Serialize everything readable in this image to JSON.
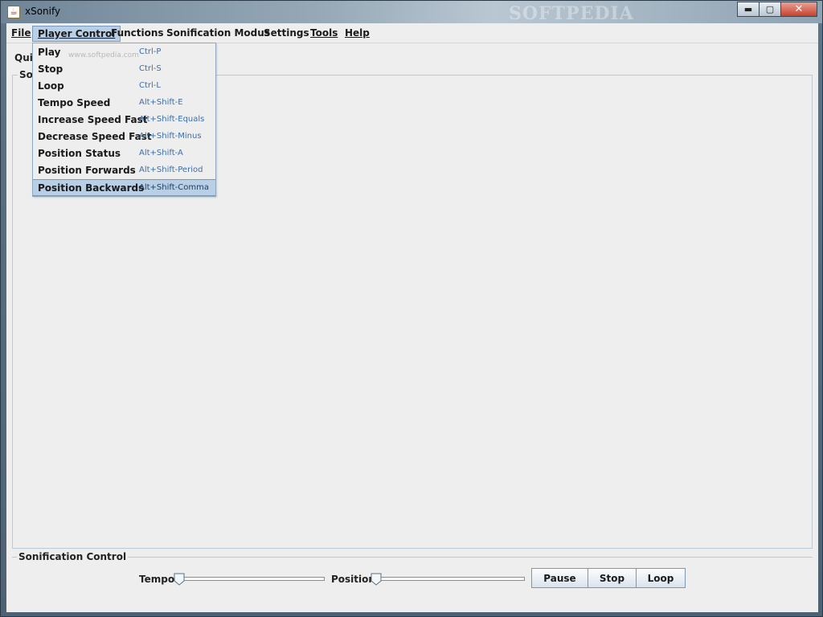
{
  "window": {
    "title": "xSonify",
    "app_icon": "java-cup-icon",
    "watermark": "SOFTPEDIA",
    "controls": {
      "minimize": "▬",
      "maximize": "▢",
      "close": "✕"
    }
  },
  "menubar": {
    "items": [
      {
        "label": "File"
      },
      {
        "label": "Player Control"
      },
      {
        "label": "Functions"
      },
      {
        "label": "Sonification Modus"
      },
      {
        "label": "Settings"
      },
      {
        "label": "Tools"
      },
      {
        "label": "Help"
      }
    ]
  },
  "dropdown": {
    "watermark": "www.softpedia.com",
    "items": [
      {
        "label": "Play",
        "accel": "Ctrl-P"
      },
      {
        "label": "Stop",
        "accel": "Ctrl-S"
      },
      {
        "label": "Loop",
        "accel": "Ctrl-L"
      },
      {
        "label": "Tempo Speed",
        "accel": "Alt+Shift-E"
      },
      {
        "label": "Increase Speed Fast",
        "accel": "Alt+Shift-Equals"
      },
      {
        "label": "Decrease Speed Fast",
        "accel": "Alt+Shift-Minus"
      },
      {
        "label": "Position Status",
        "accel": "Alt+Shift-A"
      },
      {
        "label": "Position Forwards",
        "accel": "Alt+Shift-Period"
      },
      {
        "label": "Position Backwards",
        "accel": "Alt+Shift-Comma"
      }
    ],
    "selected_index": 8
  },
  "main": {
    "quick_label": "Quic",
    "panel_title": "Son"
  },
  "control": {
    "title": "Sonification Control",
    "tempo_label": "Tempo",
    "position_label": "Position:",
    "tempo_value": 0,
    "position_value": 0,
    "buttons": {
      "pause": "Pause",
      "stop": "Stop",
      "loop": "Loop"
    }
  },
  "colors": {
    "menu_highlight": "#b8cfe5",
    "accelerator_text": "#3b6eaa",
    "panel_border": "#bcc9d6"
  }
}
